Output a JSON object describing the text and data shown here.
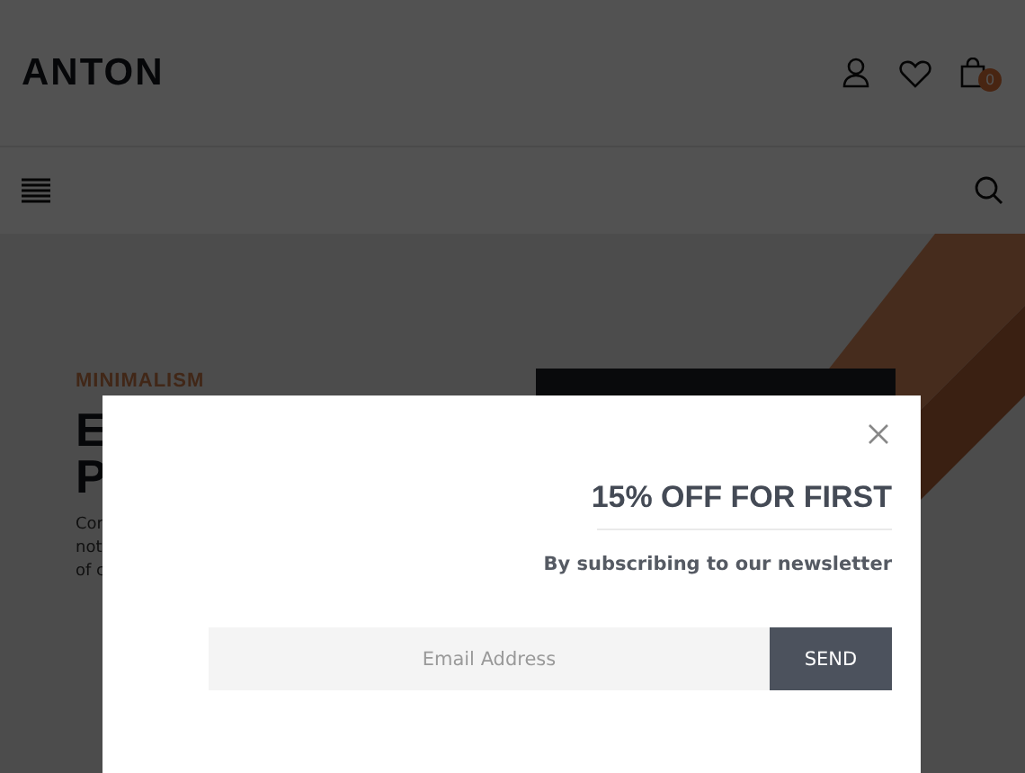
{
  "header": {
    "logo": "ANTON",
    "cart_count": "0"
  },
  "hero": {
    "label": "MINIMALISM",
    "heading_lines": [
      "E",
      "P"
    ],
    "text_lines": [
      "Cor",
      "not",
      "of c"
    ],
    "kind": "picture"
  },
  "popup": {
    "title": "15% OFF FOR FIRST",
    "subtitle": "By subscribing to our newsletter",
    "email": {
      "placeholder": "Email Address"
    },
    "button": "SEND"
  }
}
